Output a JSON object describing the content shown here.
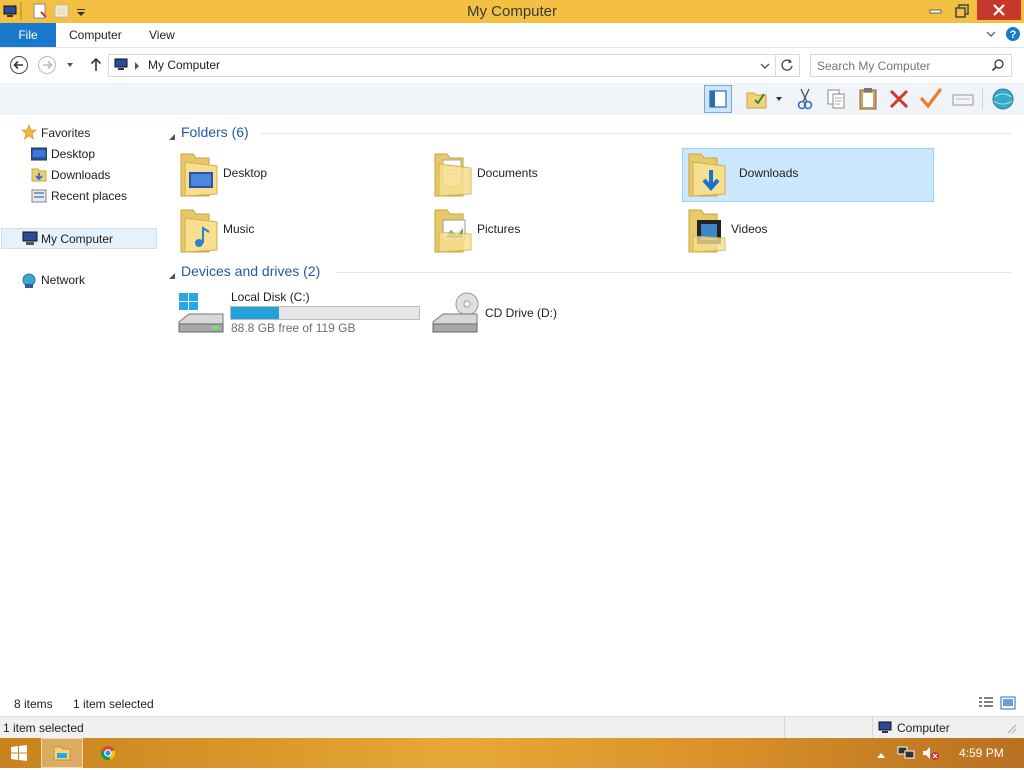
{
  "window": {
    "title": "My Computer"
  },
  "ribbon": {
    "tabs": [
      {
        "label": "File"
      },
      {
        "label": "Computer"
      },
      {
        "label": "View"
      }
    ]
  },
  "address": {
    "path_item": "My Computer"
  },
  "search": {
    "placeholder": "Search My Computer"
  },
  "navpane": {
    "favorites_label": "Favorites",
    "favorites": [
      {
        "label": "Desktop"
      },
      {
        "label": "Downloads"
      },
      {
        "label": "Recent places"
      }
    ],
    "my_computer_label": "My Computer",
    "network_label": "Network"
  },
  "groups": {
    "folders": {
      "header": "Folders (6)",
      "items": [
        {
          "label": "Desktop"
        },
        {
          "label": "Documents"
        },
        {
          "label": "Downloads"
        },
        {
          "label": "Music"
        },
        {
          "label": "Pictures"
        },
        {
          "label": "Videos"
        }
      ]
    },
    "devices": {
      "header": "Devices and drives (2)",
      "local_disk": {
        "label": "Local Disk (C:)",
        "used_fraction": 0.254,
        "free_text": "88.8 GB free of 119 GB"
      },
      "cd_drive": {
        "label": "CD Drive (D:)"
      }
    }
  },
  "status": {
    "items": "8 items",
    "selected": "1 item selected"
  },
  "status2": {
    "selected": "1 item selected",
    "location": "Computer"
  },
  "taskbar": {
    "time": "4:59 PM"
  },
  "colors": {
    "title_bar": "#f3c044",
    "file_tab": "#1979ca",
    "selection": "#cce8ff",
    "progress": "#26a0da",
    "close_button": "#c7382c"
  }
}
